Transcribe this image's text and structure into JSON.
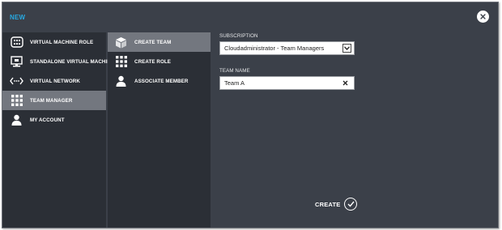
{
  "dialog": {
    "title": "NEW"
  },
  "categories": [
    {
      "label": "VIRTUAL MACHINE ROLE",
      "icon": "vm-role-icon",
      "selected": false
    },
    {
      "label": "STANDALONE VIRTUAL MACHINE",
      "icon": "monitor-icon",
      "selected": false
    },
    {
      "label": "VIRTUAL NETWORK",
      "icon": "network-icon",
      "selected": false
    },
    {
      "label": "TEAM MANAGER",
      "icon": "grid-icon",
      "selected": true
    },
    {
      "label": "MY ACCOUNT",
      "icon": "person-icon",
      "selected": false
    }
  ],
  "actions": [
    {
      "label": "CREATE TEAM",
      "icon": "cube-icon",
      "selected": true
    },
    {
      "label": "CREATE ROLE",
      "icon": "grid-icon",
      "selected": false
    },
    {
      "label": "ASSOCIATE MEMBER",
      "icon": "person-icon",
      "selected": false
    }
  ],
  "form": {
    "subscription_label": "SUBSCRIPTION",
    "subscription_value": "Cloudadministrator - Team Managers",
    "team_name_label": "TEAM NAME",
    "team_name_value": "Team A"
  },
  "footer": {
    "create_label": "CREATE"
  },
  "colors": {
    "title": "#27a8e0",
    "background": "#3b4049",
    "panel": "#2b2f36",
    "selected": "#73777f"
  }
}
